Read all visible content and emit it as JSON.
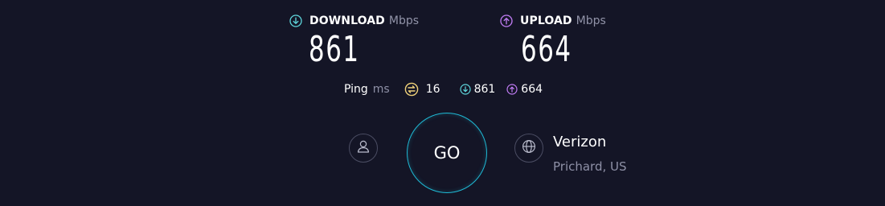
{
  "download": {
    "title": "DOWNLOAD",
    "unit": "Mbps",
    "value": "861",
    "icon": "arrow-down-circle-icon",
    "color": "#5fd6dc"
  },
  "upload": {
    "title": "UPLOAD",
    "unit": "Mbps",
    "value": "664",
    "icon": "arrow-up-circle-icon",
    "color": "#c07cf4"
  },
  "ping": {
    "label": "Ping",
    "unit": "ms",
    "value": "16",
    "icon": "ping-icon",
    "icon_color": "#f0d27a",
    "download_value": "861",
    "upload_value": "664"
  },
  "controls": {
    "go_label": "GO",
    "go_ring_color": "#1fb9d4",
    "user_icon": "user-icon",
    "globe_icon": "globe-icon"
  },
  "server": {
    "provider": "Verizon",
    "location": "Prichard, US"
  }
}
